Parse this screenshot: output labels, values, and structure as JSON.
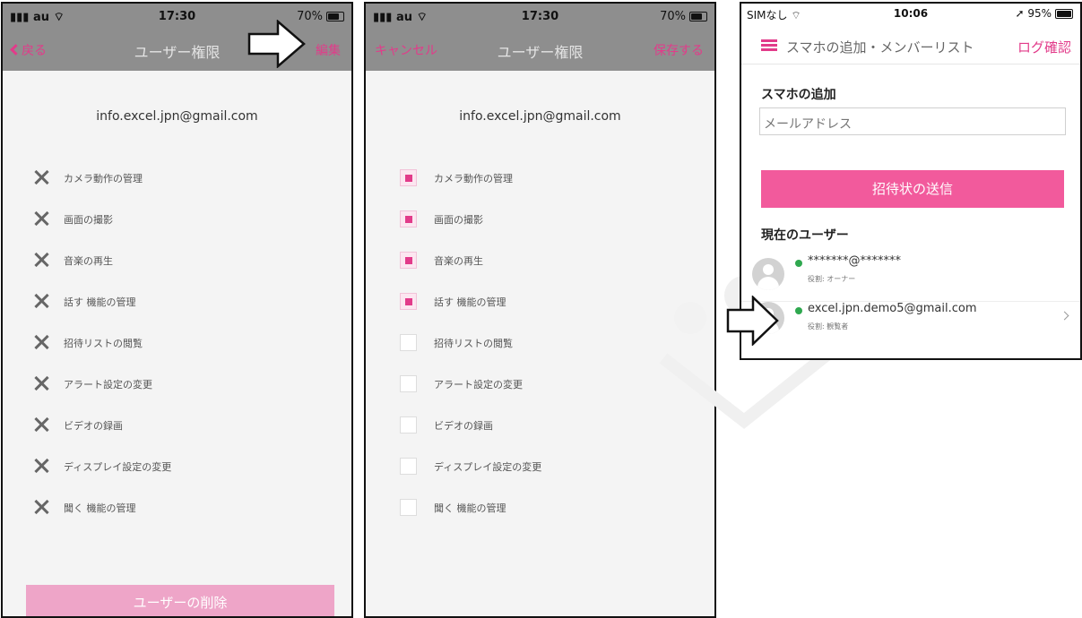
{
  "panel_left": {
    "status": {
      "carrier": "au",
      "time": "17:30",
      "battery": "70%"
    },
    "nav": {
      "back_label": "戻る",
      "title": "ユーザー権限",
      "edit_label": "編集"
    },
    "email": "info.excel.jpn@gmail.com",
    "permissions": [
      {
        "label": "カメラ動作の管理"
      },
      {
        "label": "画面の撮影"
      },
      {
        "label": "音楽の再生"
      },
      {
        "label": "話す 機能の管理"
      },
      {
        "label": "招待リストの閲覧"
      },
      {
        "label": "アラート設定の変更"
      },
      {
        "label": "ビデオの録画"
      },
      {
        "label": "ディスプレイ設定の変更"
      },
      {
        "label": "聞く 機能の管理"
      }
    ],
    "delete_button": "ユーザーの削除"
  },
  "panel_middle": {
    "status": {
      "carrier": "au",
      "time": "17:30",
      "battery": "70%"
    },
    "nav": {
      "cancel_label": "キャンセル",
      "title": "ユーザー権限",
      "save_label": "保存する"
    },
    "email": "info.excel.jpn@gmail.com",
    "permissions": [
      {
        "label": "カメラ動作の管理",
        "checked": true
      },
      {
        "label": "画面の撮影",
        "checked": true
      },
      {
        "label": "音楽の再生",
        "checked": true
      },
      {
        "label": "話す 機能の管理",
        "checked": true
      },
      {
        "label": "招待リストの閲覧",
        "checked": false
      },
      {
        "label": "アラート設定の変更",
        "checked": false
      },
      {
        "label": "ビデオの録画",
        "checked": false
      },
      {
        "label": "ディスプレイ設定の変更",
        "checked": false
      },
      {
        "label": "聞く 機能の管理",
        "checked": false
      }
    ]
  },
  "panel_right": {
    "status": {
      "carrier": "SIMなし",
      "time": "10:06",
      "battery": "95%"
    },
    "header": {
      "title": "スマホの追加・メンバーリスト",
      "log_link": "ログ確認"
    },
    "add_section_title": "スマホの追加",
    "email_placeholder": "メールアドレス",
    "invite_button": "招待状の送信",
    "current_users_title": "現在のユーザー",
    "users": [
      {
        "email": "*******@*******",
        "role": "役割: オーナー"
      },
      {
        "email": "excel.jpn.demo5@gmail.com",
        "role": "役割: 観覧者"
      }
    ]
  },
  "colors": {
    "accent": "#e23b8a",
    "nav_bar": "#8e8e8e",
    "delete_button": "#eea5c8",
    "invite_button": "#f25a9c",
    "online": "#2fa84f"
  },
  "icons": [
    "x-mark-icon",
    "checkbox-icon",
    "hamburger-icon",
    "avatar-icon",
    "chevron-right-icon",
    "arrow-right-icon",
    "wifi-icon",
    "battery-icon"
  ]
}
